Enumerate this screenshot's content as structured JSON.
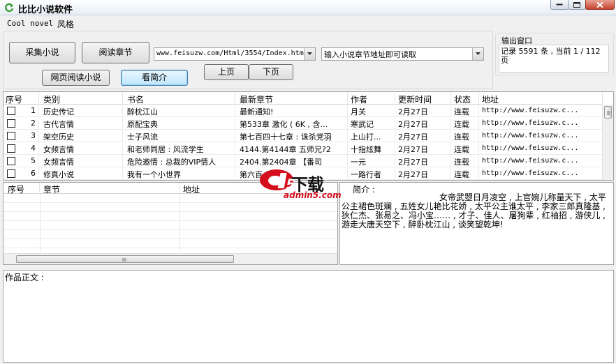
{
  "window": {
    "title": "比比小说软件"
  },
  "menu": [
    "Cool novel",
    "风格"
  ],
  "toolbar": {
    "collect_label": "采集小说",
    "read_chapter_label": "阅读章节",
    "web_read_label": "网页阅读小说",
    "view_summary_label": "看简介",
    "prev_page_label": "上页",
    "next_page_label": "下页",
    "url_value": "www.feisuzw.com/Html/3554/Index.html",
    "chapter_url_value": "输入小说章节地址即可读取"
  },
  "output": {
    "label": "输出窗口",
    "text": "记录 5591 条 , 当前 1 / 112 页"
  },
  "grid": {
    "columns": [
      "序号",
      "类别",
      "书名",
      "最新章节",
      "作者",
      "更新时间",
      "状态",
      "地址"
    ],
    "rows": [
      {
        "no": "1",
        "category": "历史传记",
        "title": "醉枕江山",
        "latest": "最新通知!",
        "author": "月关",
        "updated": "2月27日",
        "status": "连载",
        "url": "http://www.feisuzw.c..."
      },
      {
        "no": "2",
        "category": "古代言情",
        "title": "原配宝典",
        "latest": "第533章 激化 ( 6K , 含...",
        "author": "寒武记",
        "updated": "2月27日",
        "status": "连载",
        "url": "http://www.feisuzw.c..."
      },
      {
        "no": "3",
        "category": "架空历史",
        "title": "士子风流",
        "latest": "第七百四十七章 : 诛杀党羽",
        "author": "上山打...",
        "updated": "2月27日",
        "status": "连载",
        "url": "http://www.feisuzw.c..."
      },
      {
        "no": "4",
        "category": "女频言情",
        "title": "和老师同居 : 风流学生",
        "latest": "4144.第4144章 五师兄?2",
        "author": "十指炫舞",
        "updated": "2月27日",
        "status": "连载",
        "url": "http://www.feisuzw.c..."
      },
      {
        "no": "5",
        "category": "女频言情",
        "title": "危险邀情 : 总裁的VIP情人",
        "latest": "2404.第2404章 【番司",
        "author": "一元",
        "updated": "2月27日",
        "status": "连载",
        "url": "http://www.feisuzw.c..."
      },
      {
        "no": "6",
        "category": "修真小说",
        "title": "我有一个小世界",
        "latest": "第六百",
        "author": "一路行者",
        "updated": "2月27日",
        "status": "连载",
        "url": "http://www.feisuzw.c..."
      }
    ]
  },
  "chapters": {
    "columns": [
      "序号",
      "章节",
      "地址"
    ]
  },
  "summary": {
    "label": "简介 :",
    "text": "女帝武曌日月凌空 , 上官婉儿称量天下 , 太平公主裙色斑斓 , 五姓女儿艳比花娇 , 太平公主谁太平 , 李家三郎真隆基 , 狄仁杰、张易之、冯小宝…… , 才子、佳人、屠狗辈 , 红袖招 , 游侠儿 , 游走大唐天空下 , 醉卧枕江山 , 谈笑望乾坤!"
  },
  "content": {
    "label": "作品正文 :"
  },
  "watermark": {
    "brand": "下载",
    "site": "admin5.com"
  },
  "colors": {
    "title_icon": "#2e9a2e",
    "watermark_red": "#d40e1d"
  }
}
